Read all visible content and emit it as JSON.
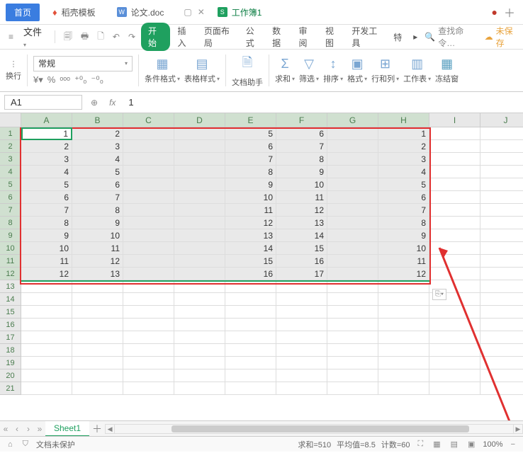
{
  "tabs": {
    "home": "首页",
    "template": "稻壳模板",
    "doc": "论文.doc",
    "sheet": "工作簿1"
  },
  "menu": {
    "file": "文件",
    "start": "开始",
    "insert": "插入",
    "layout": "页面布局",
    "formula": "公式",
    "data": "数据",
    "review": "审阅",
    "view": "视图",
    "devtool": "开发工具",
    "special": "特",
    "search": "查找命令…",
    "unsaved": "未保存"
  },
  "ribbon": {
    "wrap": "换行",
    "format": "常规",
    "condfmt": "条件格式",
    "tblstyle": "表格样式",
    "dochelper": "文档助手",
    "sum": "求和",
    "filter": "筛选",
    "sort": "排序",
    "cellfmt": "格式",
    "rowcol": "行和列",
    "worksheet": "工作表",
    "freeze": "冻结窗"
  },
  "namebox": "A1",
  "formula_val": "1",
  "columns": [
    "A",
    "B",
    "C",
    "D",
    "E",
    "F",
    "G",
    "H",
    "I",
    "J"
  ],
  "selectedCols": 8,
  "rowCount": 21,
  "selectedRows": 12,
  "chart_data": {
    "type": "table",
    "columns": [
      "A",
      "B",
      "C",
      "D",
      "E",
      "F",
      "G",
      "H"
    ],
    "rows": [
      [
        1,
        2,
        "",
        "",
        5,
        6,
        "",
        1
      ],
      [
        2,
        3,
        "",
        "",
        6,
        7,
        "",
        2
      ],
      [
        3,
        4,
        "",
        "",
        7,
        8,
        "",
        3
      ],
      [
        4,
        5,
        "",
        "",
        8,
        9,
        "",
        4
      ],
      [
        5,
        6,
        "",
        "",
        9,
        10,
        "",
        5
      ],
      [
        6,
        7,
        "",
        "",
        10,
        11,
        "",
        6
      ],
      [
        7,
        8,
        "",
        "",
        11,
        12,
        "",
        7
      ],
      [
        8,
        9,
        "",
        "",
        12,
        13,
        "",
        8
      ],
      [
        9,
        10,
        "",
        "",
        13,
        14,
        "",
        9
      ],
      [
        10,
        11,
        "",
        "",
        14,
        15,
        "",
        10
      ],
      [
        11,
        12,
        "",
        "",
        15,
        16,
        "",
        11
      ],
      [
        12,
        13,
        "",
        "",
        16,
        17,
        "",
        12
      ]
    ]
  },
  "sheet_tab": "Sheet1",
  "status": {
    "protect": "文档未保护",
    "sum": "求和=510",
    "avg": "平均值=8.5",
    "count": "计数=60",
    "zoom": "100%"
  }
}
